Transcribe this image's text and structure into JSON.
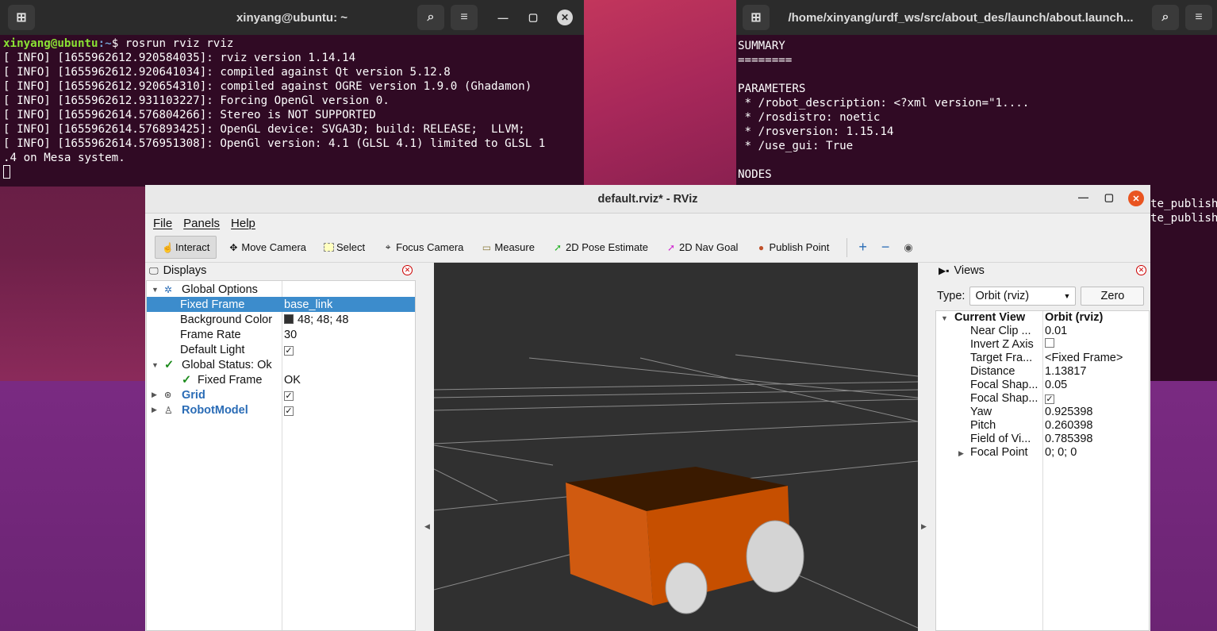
{
  "terminal_left": {
    "title": "xinyang@ubuntu: ~",
    "prompt_user": "xinyang@ubuntu",
    "prompt_path": ":~",
    "command": "$ rosrun rviz rviz",
    "lines": [
      "[ INFO] [1655962612.920584035]: rviz version 1.14.14",
      "[ INFO] [1655962612.920641034]: compiled against Qt version 5.12.8",
      "[ INFO] [1655962612.920654310]: compiled against OGRE version 1.9.0 (Ghadamon)",
      "[ INFO] [1655962612.931103227]: Forcing OpenGl version 0.",
      "[ INFO] [1655962614.576804266]: Stereo is NOT SUPPORTED",
      "[ INFO] [1655962614.576893425]: OpenGL device: SVGA3D; build: RELEASE;  LLVM;",
      "[ INFO] [1655962614.576951308]: OpenGl version: 4.1 (GLSL 4.1) limited to GLSL 1",
      ".4 on Mesa system."
    ]
  },
  "terminal_right": {
    "title": "/home/xinyang/urdf_ws/src/about_des/launch/about.launch...",
    "lines": [
      "SUMMARY",
      "========",
      "",
      "PARAMETERS",
      " * /robot_description: <?xml version=\"1....",
      " * /rosdistro: noetic",
      " * /rosversion: 1.15.14",
      " * /use_gui: True",
      "",
      "NODES"
    ],
    "overflow_lines": [
      "te_publish",
      "te_publish"
    ]
  },
  "rviz": {
    "title": "default.rviz* - RViz",
    "menu": [
      "File",
      "Panels",
      "Help"
    ],
    "tools": [
      {
        "label": "Interact",
        "icon": "hand-icon"
      },
      {
        "label": "Move Camera",
        "icon": "move-camera-icon"
      },
      {
        "label": "Select",
        "icon": "select-icon"
      },
      {
        "label": "Focus Camera",
        "icon": "focus-camera-icon"
      },
      {
        "label": "Measure",
        "icon": "ruler-icon"
      },
      {
        "label": "2D Pose Estimate",
        "icon": "green-arrow-icon"
      },
      {
        "label": "2D Nav Goal",
        "icon": "magenta-arrow-icon"
      },
      {
        "label": "Publish Point",
        "icon": "pin-icon"
      }
    ],
    "displays": {
      "header": "Displays",
      "rows": {
        "global_options": "Global Options",
        "fixed_frame": "Fixed Frame",
        "fixed_frame_val": "base_link",
        "bg_color": "Background Color",
        "bg_color_val": "48; 48; 48",
        "frame_rate": "Frame Rate",
        "frame_rate_val": "30",
        "default_light": "Default Light",
        "global_status": "Global Status: Ok",
        "status_fixed_frame": "Fixed Frame",
        "status_fixed_frame_val": "OK",
        "grid": "Grid",
        "robot_model": "RobotModel"
      }
    },
    "views": {
      "header": "Views",
      "type_label": "Type:",
      "type_value": "Orbit (rviz)",
      "zero_button": "Zero",
      "current_view": "Current View",
      "current_view_val": "Orbit (rviz)",
      "props": [
        {
          "name": "Near Clip ...",
          "value": "0.01"
        },
        {
          "name": "Invert Z Axis",
          "value": ""
        },
        {
          "name": "Target Fra...",
          "value": "<Fixed Frame>"
        },
        {
          "name": "Distance",
          "value": "1.13817"
        },
        {
          "name": "Focal Shap...",
          "value": "0.05"
        },
        {
          "name": "Focal Shap...",
          "value": ""
        },
        {
          "name": "Yaw",
          "value": "0.925398"
        },
        {
          "name": "Pitch",
          "value": "0.260398"
        },
        {
          "name": "Field of Vi...",
          "value": "0.785398"
        },
        {
          "name": "Focal Point",
          "value": "0; 0; 0"
        }
      ]
    },
    "colors": {
      "background": "#303030",
      "robot_body": "#c85000",
      "selection": "#3c8ccc"
    }
  }
}
